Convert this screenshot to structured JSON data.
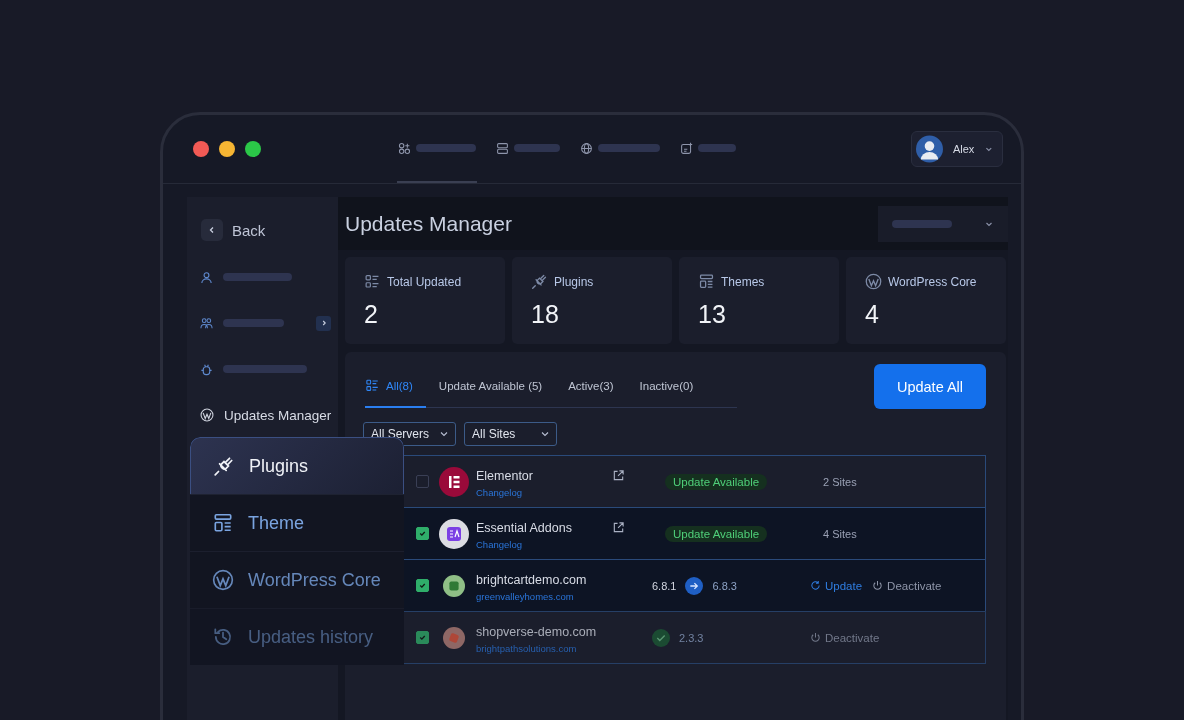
{
  "nav_tabs": [
    {
      "selected": true
    },
    {
      "selected": false
    },
    {
      "selected": false
    },
    {
      "selected": false
    }
  ],
  "user": {
    "name": "Alex"
  },
  "sidebar": {
    "back": "Back",
    "items": [
      {
        "kind": "placeholder",
        "expandable": false
      },
      {
        "kind": "placeholder",
        "expandable": true
      },
      {
        "kind": "placeholder",
        "expandable": false
      },
      {
        "kind": "link",
        "label": "Updates Manager",
        "expandable": false
      }
    ]
  },
  "page_title": "Updates Manager",
  "stats": [
    {
      "kind": "total",
      "label": "Total Updated",
      "value": "2"
    },
    {
      "kind": "plugins",
      "label": "Plugins",
      "value": "18"
    },
    {
      "kind": "themes",
      "label": "Themes",
      "value": "13"
    },
    {
      "kind": "core",
      "label": "WordPress Core",
      "value": "4"
    }
  ],
  "filter_tabs": [
    {
      "label": "All(8)",
      "selected": true
    },
    {
      "label": "Update Available (5)",
      "selected": false
    },
    {
      "label": "Active(3)",
      "selected": false
    },
    {
      "label": "Inactive(0)",
      "selected": false
    }
  ],
  "update_all": "Update All",
  "filters": [
    {
      "value": "All Servers"
    },
    {
      "value": "All Sites"
    }
  ],
  "rows": [
    {
      "kind": "plugin",
      "name": "Elementor",
      "link": "Changelog",
      "checked": false,
      "selected": false,
      "status": "Update Available",
      "sites": "2 Sites"
    },
    {
      "kind": "plugin",
      "name": "Essential Addons",
      "link": "Changelog",
      "checked": true,
      "selected": true,
      "status": "Update Available",
      "sites": "4 Sites"
    },
    {
      "kind": "site",
      "name": "brightcartdemo.com",
      "link": "greenvalleyhomes.com",
      "checked": true,
      "selected": true,
      "from": "6.8.1",
      "to": "6.8.3",
      "actions": [
        {
          "kind": "update",
          "label": "Update"
        },
        {
          "kind": "deactivate",
          "label": "Deactivate"
        }
      ]
    },
    {
      "kind": "site",
      "name": "shopverse-demo.com",
      "link": "brightpathsolutions.com",
      "checked": true,
      "selected": false,
      "to": "2.3.3",
      "actions": [
        {
          "kind": "deactivate",
          "label": "Deactivate"
        }
      ]
    }
  ],
  "menu": [
    {
      "kind": "plugin",
      "label": "Plugins",
      "selected": true
    },
    {
      "kind": "theme",
      "label": "Theme",
      "selected": false
    },
    {
      "kind": "wordpress",
      "label": "WordPress Core",
      "selected": false
    },
    {
      "kind": "history",
      "label": "Updates history",
      "selected": false
    }
  ]
}
